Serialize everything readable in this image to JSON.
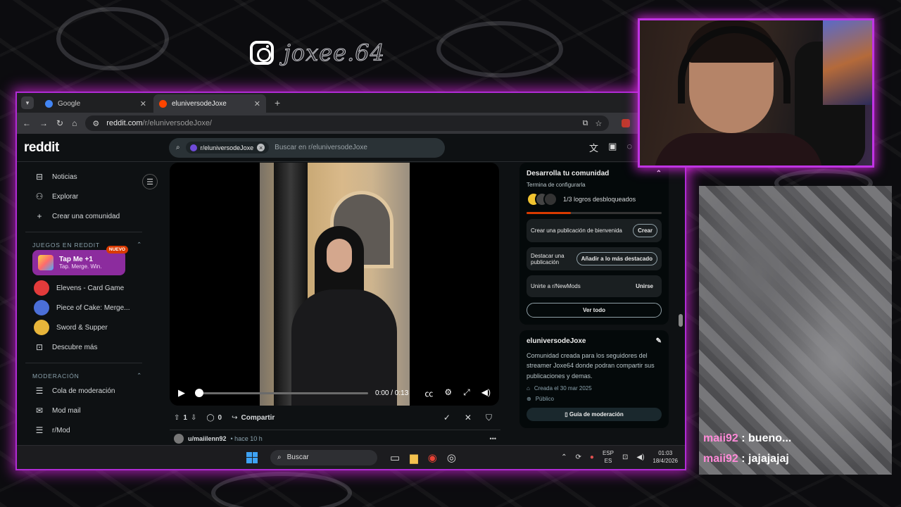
{
  "overlay": {
    "instagram_handle": "joxee.64",
    "chat": [
      {
        "user": "maii92",
        "sep": " : ",
        "message": "bueno..."
      },
      {
        "user": "maii92",
        "sep": " : ",
        "message": "jajajajaj"
      }
    ]
  },
  "browser": {
    "tabs": [
      {
        "title": "Google",
        "favicon_color": "#4285f4",
        "active": false
      },
      {
        "title": "eluniversodeJoxe",
        "favicon_color": "#ff4500",
        "active": true
      }
    ],
    "new_tab": "+",
    "address": {
      "domain": "reddit.com",
      "path": "/r/eluniversodeJoxe/"
    }
  },
  "reddit": {
    "logo": "reddit",
    "search": {
      "chip": "r/eluniversodeJoxe",
      "placeholder": "Buscar en r/eluniversodeJoxe"
    },
    "left_nav": {
      "top_items": [
        {
          "label": "Noticias",
          "icon": "news-icon"
        },
        {
          "label": "Explorar",
          "icon": "explore-icon"
        },
        {
          "label": "Crear una comunidad",
          "icon": "plus-icon"
        }
      ],
      "games_header": "JUEGOS EN REDDIT",
      "featured_game": {
        "title": "Tap Me +1",
        "subtitle": "Tap. Merge. Win.",
        "badge": "NUEVO"
      },
      "games": [
        {
          "label": "Elevens - Card Game",
          "color": "#e33b3b"
        },
        {
          "label": "Piece of Cake: Merge...",
          "color": "#4b6fd8"
        },
        {
          "label": "Sword & Supper",
          "color": "#e8b53a"
        }
      ],
      "discover": "Descubre más",
      "mod_header": "MODERACIÓN",
      "mod_items": [
        {
          "label": "Cola de moderación"
        },
        {
          "label": "Mod mail"
        },
        {
          "label": "r/Mod"
        }
      ]
    },
    "post": {
      "video": {
        "time": "0:00 / 0:13",
        "progress": 0
      },
      "votes": "1",
      "comments": "0",
      "share": "Compartir"
    },
    "next_post": {
      "user": "u/maiilenn92",
      "time": "• hace 10 h"
    },
    "sidebar": {
      "grow": {
        "title": "Desarrolla tu comunidad",
        "subtitle": "Termina de configurarla",
        "achievements": "1/3 logros desbloqueados",
        "progress": 0.33,
        "tasks": [
          {
            "text": "Crear una publicación de bienvenida",
            "button": "Crear",
            "outlined": true
          },
          {
            "text": "Destacar una publicación",
            "button": "Añadir a lo más destacado",
            "outlined": true
          },
          {
            "text": "Unirte a r/NewMods",
            "button": "Unirse",
            "outlined": false
          }
        ],
        "see_all": "Ver todo"
      },
      "about": {
        "name": "eluniversodeJoxe",
        "description": "Comunidad creada para los seguidores del streamer Joxe64 donde podran compartir sus publicaciones y demas.",
        "created": "Creada el 30 mar 2025",
        "visibility": "Público",
        "mod_guide": "Guía de moderación"
      }
    }
  },
  "taskbar": {
    "search": "Buscar",
    "lang_top": "ESP",
    "lang_bottom": "ES",
    "time": "01:03",
    "date": "18/4/2026"
  }
}
